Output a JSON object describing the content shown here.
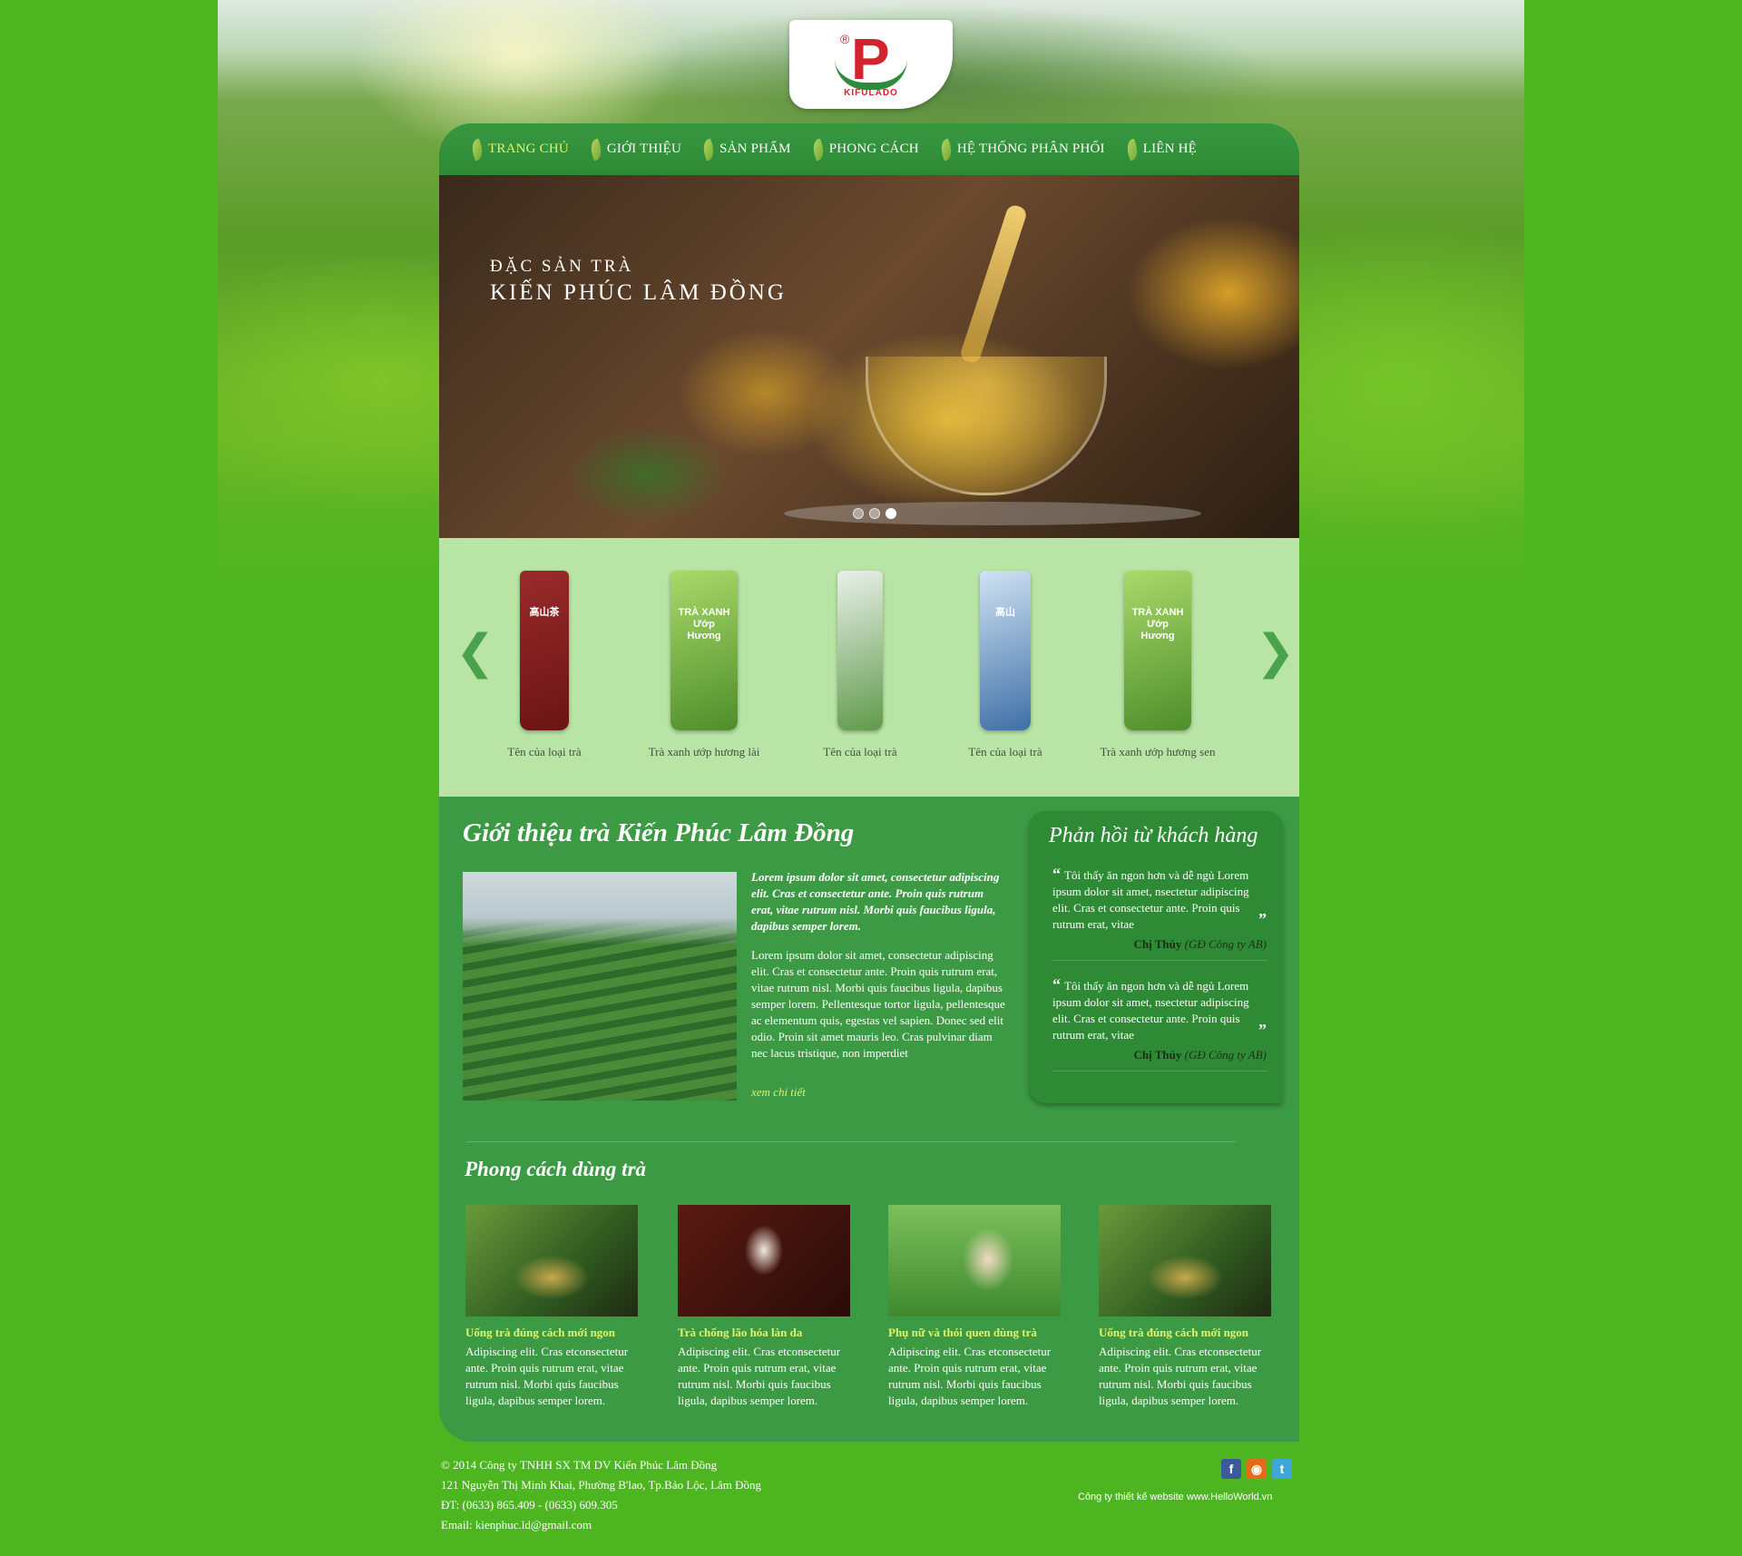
{
  "brand": {
    "logo_text": "KIFULADO",
    "reg": "®"
  },
  "nav": {
    "items": [
      {
        "label": "Trang chủ",
        "active": true
      },
      {
        "label": "Giới thiệu"
      },
      {
        "label": "Sản phẩm"
      },
      {
        "label": "Phong cách"
      },
      {
        "label": "Hệ thống phân phối"
      },
      {
        "label": "Liên hệ"
      }
    ]
  },
  "banner": {
    "subtitle": "ĐẶC SẢN TRÀ",
    "title": "KIẾN PHÚC LÂM ĐỒNG",
    "slides": 3,
    "active_slide": 3
  },
  "products": {
    "prev": "❮",
    "next": "❯",
    "items": [
      {
        "name": "Tên của loại trà",
        "label": "高山茶"
      },
      {
        "name": "Trà xanh ướp hương lài",
        "label": "TRÀ XANH Ướp Hương"
      },
      {
        "name": "Tên của loại trà",
        "label": ""
      },
      {
        "name": "Tên của loại trà",
        "label": "高山"
      },
      {
        "name": "Trà xanh ướp hương sen",
        "label": "TRÀ XANH Ướp Hương"
      }
    ]
  },
  "intro": {
    "title": "Giới thiệu trà Kiến Phúc Lâm Đồng",
    "lead": "Lorem ipsum dolor sit amet, consectetur adipiscing elit. Cras et consectetur ante. Proin quis rutrum erat, vitae rutrum nisl. Morbi quis faucibus ligula, dapibus semper lorem.",
    "body": "Lorem ipsum dolor sit amet, consectetur adipiscing elit. Cras et consectetur ante. Proin quis rutrum erat, vitae rutrum nisl. Morbi quis faucibus ligula, dapibus semper lorem. Pellentesque tortor ligula, pellentesque ac elementum quis, egestas vel sapien. Donec sed elit odio. Proin sit amet mauris leo. Cras pulvinar diam nec lacus tristique, non imperdiet",
    "more": "xem chi tiết"
  },
  "feedback": {
    "title": "Phản hồi từ khách hàng",
    "items": [
      {
        "quote": "Tôi thấy ăn ngon hơn và dễ ngủ Lorem ipsum dolor sit amet, nsectetur adipiscing elit. Cras et consectetur ante. Proin quis rutrum erat, vitae",
        "name": "Chị Thủy",
        "role": "(GĐ Công ty AB)"
      },
      {
        "quote": "Tôi thấy ăn ngon hơn và dễ ngủ Lorem ipsum dolor sit amet, nsectetur adipiscing elit. Cras et consectetur ante. Proin quis rutrum erat, vitae",
        "name": "Chị Thủy",
        "role": "(GĐ Công ty AB)"
      }
    ]
  },
  "styles": {
    "title": "Phong cách dùng trà",
    "cards": [
      {
        "title": "Uống trà đúng cách mới ngon",
        "body": "Adipiscing elit. Cras etconsectetur ante. Proin quis rutrum erat, vitae rutrum nisl. Morbi quis faucibus ligula, dapibus semper lorem."
      },
      {
        "title": "Trà chống lão hóa làn da",
        "body": "Adipiscing elit. Cras etconsectetur ante. Proin quis rutrum erat, vitae rutrum nisl. Morbi quis faucibus ligula, dapibus semper lorem."
      },
      {
        "title": "Phụ nữ và thói quen dùng trà",
        "body": "Adipiscing elit. Cras etconsectetur ante. Proin quis rutrum erat, vitae rutrum nisl. Morbi quis faucibus ligula, dapibus semper lorem."
      },
      {
        "title": "Uống trà đúng cách mới ngon",
        "body": "Adipiscing elit. Cras etconsectetur ante. Proin quis rutrum erat, vitae rutrum nisl. Morbi quis faucibus ligula, dapibus semper lorem."
      }
    ]
  },
  "footer": {
    "copyright": "© 2014  Công ty TNHH SX TM DV Kiến Phúc Lâm Đồng",
    "address": "121 Nguyễn Thị Minh Khai, Phường B'lao, Tp.Bảo Lộc, Lâm Đồng",
    "phone": "ĐT: (0633) 865.409 - (0633) 609.305",
    "email": "Email: kienphuc.ld@gmail.com",
    "credit": "Công ty thiết kế website www.HelloWorld.vn",
    "social": {
      "facebook": "f",
      "rss": "◉",
      "twitter": "t"
    }
  },
  "colors": {
    "page_bg": "#4cb520",
    "panel": "#3d9a44",
    "accent_yellow": "#e4f36a",
    "product_strip": "#b8e4a5"
  }
}
